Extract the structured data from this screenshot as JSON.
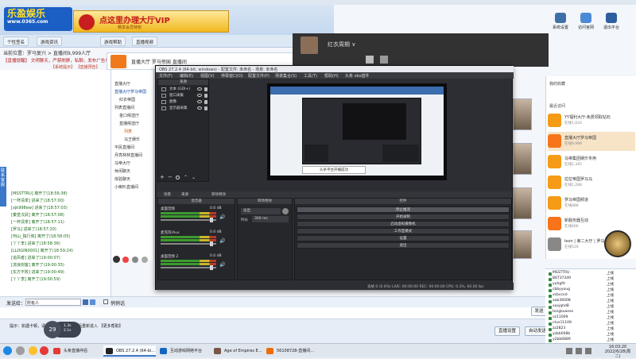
{
  "app": {
    "banner_logo": "乐盈娱乐",
    "banner_logo_sub": "www.0365.com",
    "vip_text": "点这里办理大厅VIP",
    "vip_sub": "畅享会员特权",
    "tabs": [
      "个性签名",
      "游戏资讯",
      "游戏帮助",
      "直播视频"
    ],
    "room_line": "当前位置：罗马复兴 > 直播间9,999人厅",
    "notice": "【直播提醒】 文明聊天，严禁刷屏，私聊，发布广告！",
    "notice2": "【系统提示】 【直播预告】",
    "room_header_name": "直播大厅 罗马帝国 直播间",
    "sidebar_label": "联系客服"
  },
  "chat_lines": [
    "[MSSTTRU] 离开了(18:56:38)",
    "[一杯清茶] 进来了(18:57:00)",
    "[xjk998ew] 进来了(18:57:03)",
    "[秦皇汉武] 离开了(18:57:08)",
    "[一杯清茶] 离开了(18:57:11)",
    "[罗马] 进来了(18:57:20)",
    "[何山_独行侠] 离开了(18:58:05)",
    "[丫丫李] 进来了(18:58:36)",
    "[LLOGIN0001] 离开了(18:59:24)",
    "[追风者] 进来了(19:00:07)",
    "[流浪剑客] 离开了(19:00:35)",
    "[东方不败] 进来了(19:00:49)",
    "[丫丫李] 离开了(19:00:59)"
  ],
  "room_tree": [
    "直播大厅",
    "直播大厅罗马帝国",
    "红衣帝国",
    "列表直播间",
    "金口候选厅",
    "直播候选厅",
    "列表",
    "马王娱乐",
    "平民直播间",
    "月亮林林直播间",
    "马帝大厅",
    "休闲聊天",
    "体验聊天",
    "小喇叭直播间"
  ],
  "input": {
    "target_label": "发送给：",
    "target_value": "所有人",
    "checkbox_label": "悄悄话",
    "send_button": "发送",
    "hint": "提示：如遇卡顿，请按F5或关闭直播间后重新进入 【更多帮助】",
    "timer": "29",
    "timer_pill_1": "1.3s",
    "timer_pill_2": "2.1s",
    "bottom_btn_1": "直播设置",
    "bottom_btn_2": "自动发送"
  },
  "top_icons": [
    "系统设置",
    "访问官网",
    "退出平台"
  ],
  "right_panel": {
    "header_1": "我的收藏",
    "header_2": "最近访问",
    "items": [
      {
        "title": "YY福利大厅-免费领取钻石",
        "sub": "在线1,024"
      },
      {
        "title": "直播大厅罗马帝国",
        "sub": "在线9,999"
      },
      {
        "title": "马帝集团娱乐专用",
        "sub": "在线2,345"
      },
      {
        "title": "拉拉帝国罗马马",
        "sub": "在线1,288"
      },
      {
        "title": "罗马帝国频道",
        "sub": "在线888"
      },
      {
        "title": "新服务器互动",
        "sub": "在线666"
      },
      {
        "title": "leon | 第二大厅 | 罗马",
        "sub": "在线520"
      }
    ]
  },
  "user_list": [
    {
      "name": "MSSTTRU",
      "status": "上线"
    },
    {
      "name": "B6T37349",
      "status": "上线"
    },
    {
      "name": "yuhgfd",
      "status": "上线"
    },
    {
      "name": "cbbyyoug",
      "status": "上线"
    },
    {
      "name": "xcbvcxd",
      "status": "上线"
    },
    {
      "name": "aab36008",
      "status": "上线"
    },
    {
      "name": "xaxjqhd8",
      "status": "上线"
    },
    {
      "name": "tongkuaees",
      "status": "上线"
    },
    {
      "name": "vz11009",
      "status": "上线"
    },
    {
      "name": "ctvx11109",
      "status": "上线"
    },
    {
      "name": "zz2823",
      "status": "上线"
    },
    {
      "name": "yzbb008b",
      "status": "上线"
    },
    {
      "name": "y2bb6889",
      "status": "上线"
    }
  ],
  "win2": {
    "name": "红衣周期 ∨"
  },
  "obs": {
    "title": "OBS 27.2.4 (64-bit, windows) - 配置文件: 未命名 - 场景: 未命名",
    "menu": [
      "文件(F)",
      "编辑(E)",
      "视图(V)",
      "停靠窗口(D)",
      "配置文件(P)",
      "场景集合(S)",
      "工具(T)",
      "帮助(H)",
      "头条 obs插件"
    ],
    "sources_header": "来源",
    "sources": [
      "文本 (GDI+)",
      "窗口采集",
      "图像",
      "显示器采集"
    ],
    "preview_tip": "头条平台开播成功",
    "dock_tabs": [
      "场景",
      "来源",
      "转场特效"
    ],
    "mixer_header": "混音器",
    "trans_header": "转场特效",
    "ctrl_header": "控件",
    "mixer": [
      {
        "name": "桌面音频",
        "db": "0.0 dB"
      },
      {
        "name": "麦克风/Aux",
        "db": "0.0 dB"
      },
      {
        "name": "桌面音频 2",
        "db": "0.0 dB"
      }
    ],
    "trans_type": "淡出",
    "trans_duration_label": "时长",
    "trans_duration": "300 ms",
    "controls": [
      "停止推流",
      "开始录制",
      "启动虚拟摄像机",
      "工作室模式",
      "设置",
      "退出"
    ],
    "status": "丢帧 0 (0.0%)   LIVE: 00:00:00   REC: 00:00:00   CPU: 0.3%, 60.00 fps"
  },
  "taskbar": {
    "apps": [
      "头条直播伴侣",
      "OBS 27.2.4 (64-bi...",
      "互动游戏网络平台",
      "Age of Empires E...",
      "56108728-直播间..."
    ],
    "time": "16:03:20",
    "date": "2022/6/28(周二)"
  }
}
